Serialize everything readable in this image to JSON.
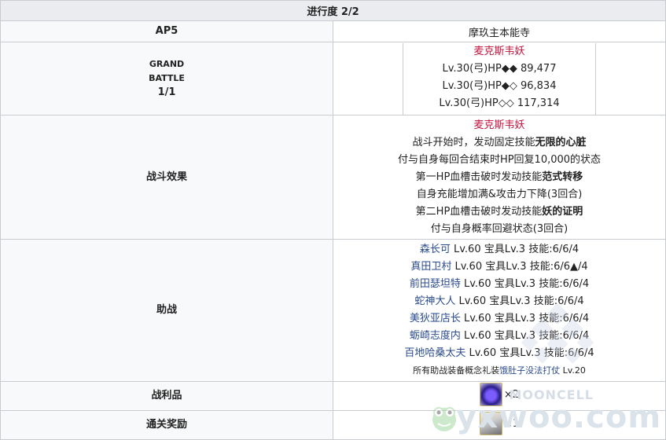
{
  "header": {
    "progress": "进行度 2/2"
  },
  "ap": {
    "label": "AP5",
    "location": "摩玖主本能寺"
  },
  "battle": {
    "label_line1": "GRAND",
    "label_line2": "BATTLE",
    "label_line3": "1/1",
    "enemy_name": "麦克斯韦妖",
    "hp_rows": [
      "Lv.30(弓)HP◆◆ 89,477",
      "Lv.30(弓)HP◆◇ 96,834",
      "Lv.30(弓)HP◇◇ 117,314"
    ]
  },
  "effect": {
    "label": "战斗效果",
    "enemy_name": "麦克斯韦妖",
    "line1_prefix": "战斗开始时，发动固定技能",
    "line1_bold": "无限的心脏",
    "line2": "付与自身每回合结束时HP回复10,000的状态",
    "line3_prefix": "第一HP血槽击破时发动技能",
    "line3_bold": "范式转移",
    "line4": "自身充能增加满&攻击力下降(3回合)",
    "line5_prefix": "第二HP血槽击破时发动技能",
    "line5_bold": "妖的证明",
    "line6": "付与自身概率回避状态(3回合)"
  },
  "support": {
    "label": "助战",
    "servants": [
      {
        "name": "森长可",
        "detail": " Lv.60 宝具Lv.3 技能:6/6/4"
      },
      {
        "name": "真田卫村",
        "detail": " Lv.60 宝具Lv.3 技能:6/6▲/4"
      },
      {
        "name": "前田瑟坦特",
        "detail": " Lv.60 宝具Lv.3 技能:6/6/4"
      },
      {
        "name": "蛇神大人",
        "detail": " Lv.60 宝具Lv.3 技能:6/6/4"
      },
      {
        "name": "美狄亚店长",
        "detail": " Lv.60 宝具Lv.3 技能:6/6/4"
      },
      {
        "name": "蛎崎志度内",
        "detail": " Lv.60 宝具Lv.3 技能:6/6/4"
      },
      {
        "name": "百地哈桑太夫",
        "detail": " Lv.60 宝具Lv.3 技能:6/6/4"
      }
    ],
    "note_prefix": "所有助战装备概念礼装",
    "note_link": "饿肚子没法打仗",
    "note_suffix": " Lv.20"
  },
  "drop": {
    "label": "战利品",
    "qty": "×2",
    "icon": "purple-orb-icon"
  },
  "reward": {
    "label": "通关奖励",
    "qty": "×1",
    "icon": "craft-essence-icon"
  },
  "watermark": {
    "site": "MOONCELL",
    "brand": "yxwoo.com"
  }
}
